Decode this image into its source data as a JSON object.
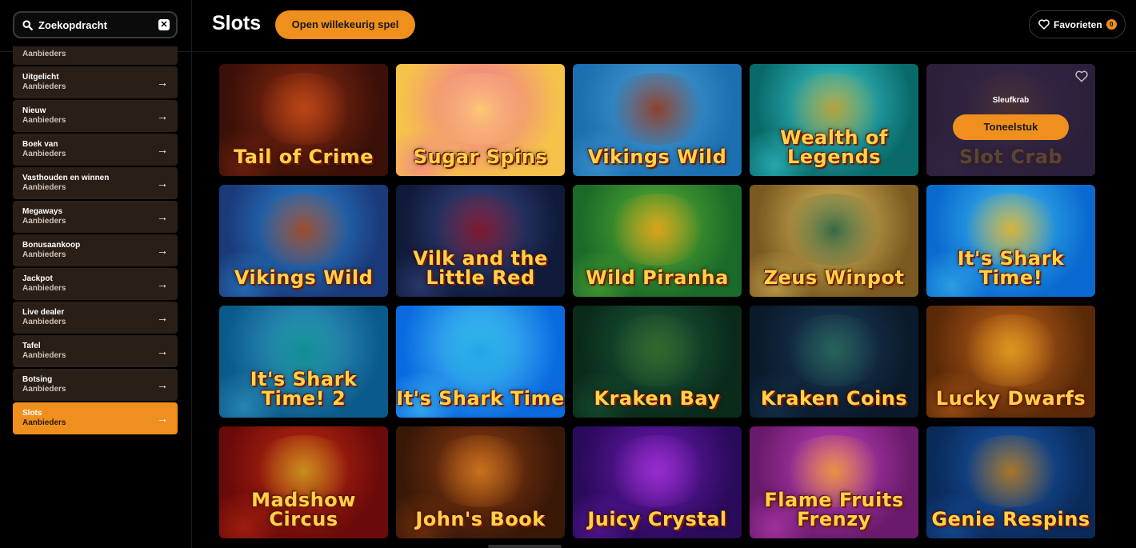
{
  "search": {
    "value": "Zoekopdracht",
    "clear_icon": "x-box-icon"
  },
  "sidebar": {
    "items": [
      {
        "label": "",
        "sub": "Aanbieders",
        "partial": true
      },
      {
        "label": "Uitgelicht",
        "sub": "Aanbieders"
      },
      {
        "label": "Nieuw",
        "sub": "Aanbieders"
      },
      {
        "label": "Boek van",
        "sub": "Aanbieders"
      },
      {
        "label": "Vasthouden en winnen",
        "sub": "Aanbieders"
      },
      {
        "label": "Megaways",
        "sub": "Aanbieders"
      },
      {
        "label": "Bonusaankoop",
        "sub": "Aanbieders"
      },
      {
        "label": "Jackpot",
        "sub": "Aanbieders"
      },
      {
        "label": "Live dealer",
        "sub": "Aanbieders"
      },
      {
        "label": "Tafel",
        "sub": "Aanbieders"
      },
      {
        "label": "Botsing",
        "sub": "Aanbieders"
      },
      {
        "label": "Slots",
        "sub": "Aanbieders",
        "active": true
      }
    ]
  },
  "header": {
    "title": "Slots",
    "random_button": "Open willekeurig spel",
    "favorites_label": "Favorieten",
    "favorites_count": "0"
  },
  "games": [
    {
      "logo": "Tail of Crime",
      "bg": [
        "#3a1008",
        "#8a2a10",
        "#c24a18"
      ]
    },
    {
      "logo": "Sugar Spins",
      "bg": [
        "#f6c24a",
        "#ef6fa0",
        "#ffd86a"
      ]
    },
    {
      "logo": "Vikings Wild",
      "bg": [
        "#1c6fb0",
        "#4aa0d8",
        "#9a3010"
      ]
    },
    {
      "logo": "Wealth of Legends",
      "bg": [
        "#0a6a6a",
        "#3ad0d8",
        "#c89a20"
      ]
    },
    {
      "logo": "Slot Crab",
      "bg": [
        "#3a2a5a",
        "#6a4a9a",
        "#c8741a"
      ],
      "hover": true,
      "provider": "Sleufkrab",
      "play": "Toneelstuk"
    },
    {
      "logo": "Vikings Wild",
      "bg": [
        "#1a3a7a",
        "#2a8ad8",
        "#b04010"
      ]
    },
    {
      "logo": "Vilk and the Little Red",
      "bg": [
        "#101a3a",
        "#3a4a8a",
        "#8a1020"
      ]
    },
    {
      "logo": "Wild Piranha",
      "bg": [
        "#1a6a2a",
        "#5ab030",
        "#f0a018"
      ]
    },
    {
      "logo": "Zeus Winpot",
      "bg": [
        "#7a5a20",
        "#e0c060",
        "#1a5a40"
      ]
    },
    {
      "logo": "It's Shark Time!",
      "bg": [
        "#0a6ad0",
        "#40c0f0",
        "#f0b020"
      ]
    },
    {
      "logo": "It's Shark Time! 2",
      "bg": [
        "#0a5a8a",
        "#3aa0c8",
        "#0a8a8a"
      ]
    },
    {
      "logo": "It's Shark Time",
      "bg": [
        "#0a6ae0",
        "#50d0f8",
        "#1aa0e0"
      ]
    },
    {
      "logo": "Kraken Bay",
      "bg": [
        "#0a2a1a",
        "#1a5a3a",
        "#3a6a2a"
      ]
    },
    {
      "logo": "Kraken Coins",
      "bg": [
        "#0a1a2a",
        "#1a3a5a",
        "#2a6a5a"
      ]
    },
    {
      "logo": "Lucky Dwarfs",
      "bg": [
        "#5a2a08",
        "#c0601a",
        "#e0a020"
      ]
    },
    {
      "logo": "Madshow Circus",
      "bg": [
        "#6a0a0a",
        "#c02a10",
        "#c8a020"
      ]
    },
    {
      "logo": "John's Book",
      "bg": [
        "#3a1808",
        "#8a3a10",
        "#d07a20"
      ]
    },
    {
      "logo": "Juicy Crystal",
      "bg": [
        "#2a0a5a",
        "#6a1ab0",
        "#a030d0"
      ]
    },
    {
      "logo": "Flame Fruits Frenzy",
      "bg": [
        "#6a1a6a",
        "#c040c0",
        "#f0a030"
      ]
    },
    {
      "logo": "Genie Respins",
      "bg": [
        "#0a2a5a",
        "#1a5ab0",
        "#c07a10"
      ]
    }
  ],
  "colors": {
    "accent": "#ef8f1e",
    "nav_bg": "#2a1f17",
    "page_bg": "#000000"
  },
  "icons": {
    "search": "search-icon",
    "arrow": "arrow-right-icon",
    "heart": "heart-icon"
  }
}
